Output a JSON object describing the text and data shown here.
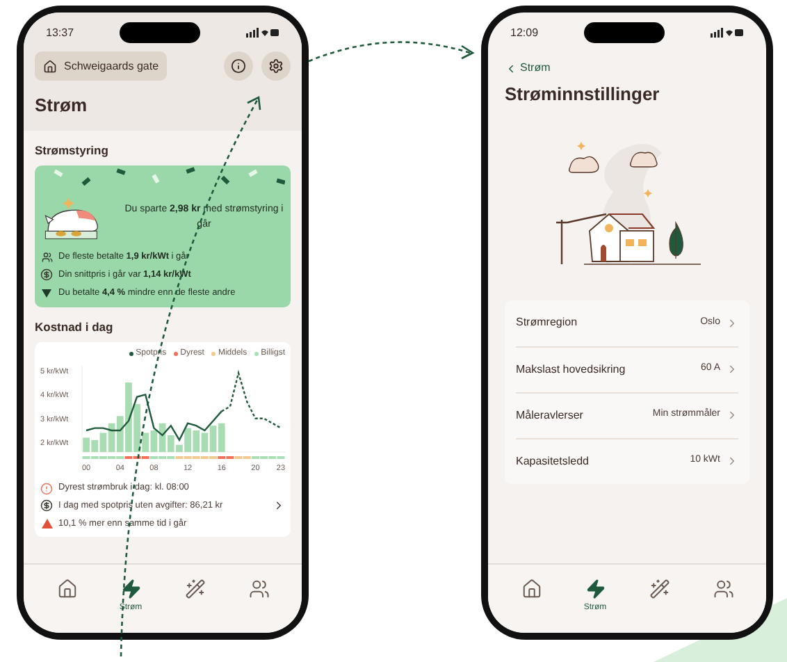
{
  "left_phone": {
    "status_time": "13:37",
    "location": "Schweigaards gate",
    "title": "Strøm",
    "steering": {
      "heading": "Strømstyring",
      "headline": "Du sparte **2,98 kr** med strømstyring i går",
      "facts": [
        {
          "kind": "crowd",
          "text": "De fleste betalte **1,9 kr/kWt** i går"
        },
        {
          "kind": "coin",
          "text": "Din snittpris i går var **1,14 kr/kWt**"
        },
        {
          "kind": "down",
          "text": "Du betalte **4,4 %** mindre enn de fleste andre"
        }
      ]
    },
    "cost": {
      "heading": "Kostnad i dag",
      "legend": [
        {
          "label": "Dyrest",
          "color": "#f0705a"
        },
        {
          "label": "Middels",
          "color": "#f3c98f"
        },
        {
          "label": "Billigst",
          "color": "#a8e0b4"
        }
      ],
      "chart_data": {
        "type": "bar",
        "x": [
          0,
          1,
          2,
          3,
          4,
          5,
          6,
          7,
          8,
          9,
          10,
          11,
          12,
          13,
          14,
          15,
          16,
          17,
          18,
          19,
          20,
          21,
          22,
          23
        ],
        "xlim": [
          -0.5,
          23.5
        ],
        "ylim": [
          1.6,
          5.2
        ],
        "yticks": [
          {
            "value": 2,
            "label": "2 kr/kWt"
          },
          {
            "value": 3,
            "label": "3 kr/kWt"
          },
          {
            "value": 4,
            "label": "4 kr/kWt"
          },
          {
            "value": 5,
            "label": "5 kr/kWt"
          }
        ],
        "xticks": [
          {
            "value": 0,
            "label": "00"
          },
          {
            "value": 4,
            "label": "04"
          },
          {
            "value": 8,
            "label": "08"
          },
          {
            "value": 12,
            "label": "12"
          },
          {
            "value": 16,
            "label": "16"
          },
          {
            "value": 20,
            "label": "20"
          },
          {
            "value": 23,
            "label": "23"
          }
        ],
        "series": [
          {
            "type": "bar",
            "color": "#a8dcb2",
            "values": [
              2.2,
              2.1,
              2.4,
              2.8,
              3.1,
              4.5,
              3.6,
              2.4,
              2.5,
              2.8,
              2.3,
              1.9,
              2.6,
              2.5,
              2.4,
              2.7,
              2.8,
              null,
              null,
              null,
              null,
              null,
              null,
              null
            ]
          },
          {
            "name": "Spotpris",
            "type": "line",
            "color": "#1f5a3c",
            "values": [
              2.5,
              2.6,
              2.6,
              2.5,
              2.5,
              2.9,
              3.9,
              4.0,
              2.6,
              2.3,
              2.7,
              2.1,
              2.8,
              2.7,
              2.5,
              2.9,
              3.3,
              3.5,
              4.9,
              3.7,
              3.0,
              3.0,
              2.8,
              2.6
            ]
          }
        ]
      },
      "price_bands": [
        {
          "color": "#a8e0b4"
        },
        {
          "color": "#a8e0b4"
        },
        {
          "color": "#a8e0b4"
        },
        {
          "color": "#a8e0b4"
        },
        {
          "color": "#a8e0b4"
        },
        {
          "color": "#f0705a"
        },
        {
          "color": "#f0705a"
        },
        {
          "color": "#f0705a"
        },
        {
          "color": "#a8e0b4"
        },
        {
          "color": "#a8e0b4"
        },
        {
          "color": "#a8e0b4"
        },
        {
          "color": "#f3c98f"
        },
        {
          "color": "#f3c98f"
        },
        {
          "color": "#f3c98f"
        },
        {
          "color": "#f3c98f"
        },
        {
          "color": "#f3c98f"
        },
        {
          "color": "#f0705a"
        },
        {
          "color": "#f0705a"
        },
        {
          "color": "#f3c98f"
        },
        {
          "color": "#f3c98f"
        },
        {
          "color": "#a8e0b4"
        },
        {
          "color": "#a8e0b4"
        },
        {
          "color": "#a8e0b4"
        },
        {
          "color": "#a8e0b4"
        }
      ],
      "info": [
        {
          "kind": "alert",
          "text": "Dyrest strømbruk i dag: kl. 08:00",
          "chevron": false
        },
        {
          "kind": "coin",
          "text": "I dag med spotpris uten avgifter: 86,21 kr",
          "chevron": true
        },
        {
          "kind": "up",
          "text": "10,1 % mer enn samme tid i går",
          "chevron": false
        }
      ]
    },
    "nav": [
      {
        "kind": "home",
        "selected": false
      },
      {
        "kind": "bolt",
        "label": "Strøm",
        "selected": true
      },
      {
        "kind": "wand",
        "selected": false
      },
      {
        "kind": "people",
        "selected": false
      }
    ]
  },
  "right_phone": {
    "status_time": "12:09",
    "back": "Strøm",
    "title": "Strøminnstillinger",
    "settings": [
      {
        "label": "Strømregion",
        "value": "Oslo"
      },
      {
        "label": "Makslast hovedsikring",
        "value": "60 A"
      },
      {
        "label": "Måleravlerser",
        "value": "Min strømmåler"
      },
      {
        "label": "Kapasitetsledd",
        "value": "10 kWt"
      }
    ],
    "nav": [
      {
        "kind": "home",
        "selected": false
      },
      {
        "kind": "bolt",
        "label": "Strøm",
        "selected": true
      },
      {
        "kind": "wand",
        "selected": false
      },
      {
        "kind": "people",
        "selected": false
      }
    ]
  }
}
